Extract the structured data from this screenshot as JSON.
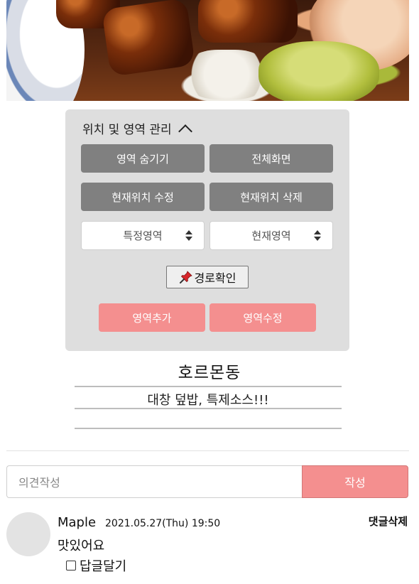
{
  "panel": {
    "title": "위치 및 영역 관리",
    "buttons": {
      "hide_area": "영역 숨기기",
      "fullscreen": "전체화면",
      "edit_location": "현재위치 수정",
      "delete_location": "현재위치 삭제",
      "check_route": "경로확인",
      "add_area": "영역추가",
      "edit_area": "영역수정"
    },
    "selects": {
      "specific_area": "특정영역",
      "current_area": "현재영역"
    }
  },
  "place": {
    "name": "호르몬동",
    "description": "대창 덮밥, 특제소스!!!"
  },
  "comment_form": {
    "placeholder": "의견작성",
    "submit_label": "작성"
  },
  "comments": [
    {
      "author": "Maple",
      "date": "2021.05.27(Thu) 19:50",
      "text": "맛있어요",
      "delete_label": "댓글삭제",
      "reply_label": "답글달기"
    }
  ],
  "colors": {
    "accent_pink": "#f48f8f",
    "button_gray": "#808080",
    "panel_bg": "#dedede"
  },
  "icons": [
    "chevron-up-icon",
    "pushpin-icon",
    "select-arrows-icon"
  ]
}
